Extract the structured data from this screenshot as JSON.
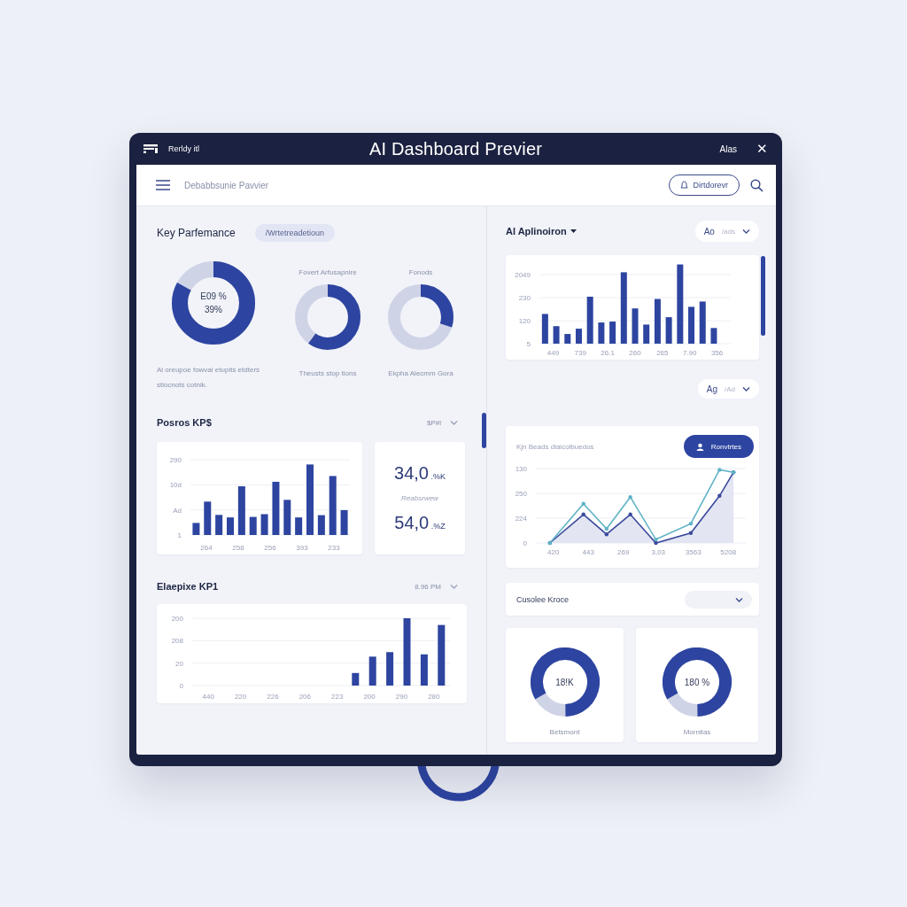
{
  "window": {
    "app_label": "Rerldy itl",
    "title": "AI Dashboard Previer",
    "user": "Alas",
    "close": "✕"
  },
  "header": {
    "breadcrumb": "Debabbsunie Pavvier",
    "action_button": "Dirtdorevr"
  },
  "left_panel": {
    "title": "Key Parfemance",
    "filter_chip": "/Wrtetreadetioun",
    "donuts": [
      {
        "values": [
          "E09 %",
          "39%"
        ],
        "level": 0.83,
        "caption": "Al oreupoe fowvai etupits etdters stiocnots cotnik."
      },
      {
        "label": "Fovert Arfusapnire",
        "level": 0.6,
        "caption": "Theusts stop tions"
      },
      {
        "label": "Fonods",
        "level": 0.3,
        "caption": "Ekpha Alecmm Gora"
      }
    ],
    "kpi_section": {
      "title": "Posros KP$",
      "time": "$P#l",
      "chart": {
        "kind": "bar",
        "y_axis_labels": [
          "290",
          "10d",
          "Ad",
          "1"
        ],
        "x_axis_labels": [
          "264",
          "258",
          "256",
          "393",
          "233"
        ]
      },
      "stats": {
        "first": {
          "value": "34,0",
          "unit": ".%K"
        },
        "label": "Reabsrwew",
        "second": {
          "value": "54,0",
          "unit": ".%Z"
        }
      }
    },
    "trend_section": {
      "title": "Elaepixe KP1",
      "time": "8.96 PM",
      "chart": {
        "kind": "bar",
        "y_axis_labels": [
          "200",
          "208",
          "20",
          "0"
        ],
        "x_axis_labels": [
          "440",
          "220",
          "226",
          "206",
          "223",
          "200",
          "290",
          "280"
        ]
      }
    }
  },
  "right_panel": {
    "title": "Al Aplinoiron",
    "dropdown": {
      "label": "Ao",
      "hint": "/ads"
    },
    "chart": {
      "kind": "bar",
      "y_axis_labels": [
        "2049",
        "230",
        "120",
        "5"
      ],
      "x_axis_labels": [
        "449",
        "739",
        "26.1",
        "260",
        "265",
        "7.90",
        "356"
      ]
    },
    "dropdown_2": {
      "label": "Ag",
      "hint": "/Ad"
    },
    "line_card": {
      "title": "Kjn Beads dlaicolbuedos",
      "button": "Ronvtrtes",
      "chart": {
        "kind": "line",
        "y_axis_labels": [
          "130",
          "250",
          "224",
          "0"
        ],
        "x_axis_labels": [
          "420",
          "443",
          "269",
          "3,03",
          "3563",
          "5208"
        ]
      }
    },
    "select_card": {
      "label": "Cusolee Kroce"
    },
    "donut_cards": [
      {
        "value": "18!K",
        "caption": "Betsmont",
        "level": 0.83
      },
      {
        "value": "180 %",
        "caption": "Morntias",
        "level": 0.83
      }
    ]
  }
}
